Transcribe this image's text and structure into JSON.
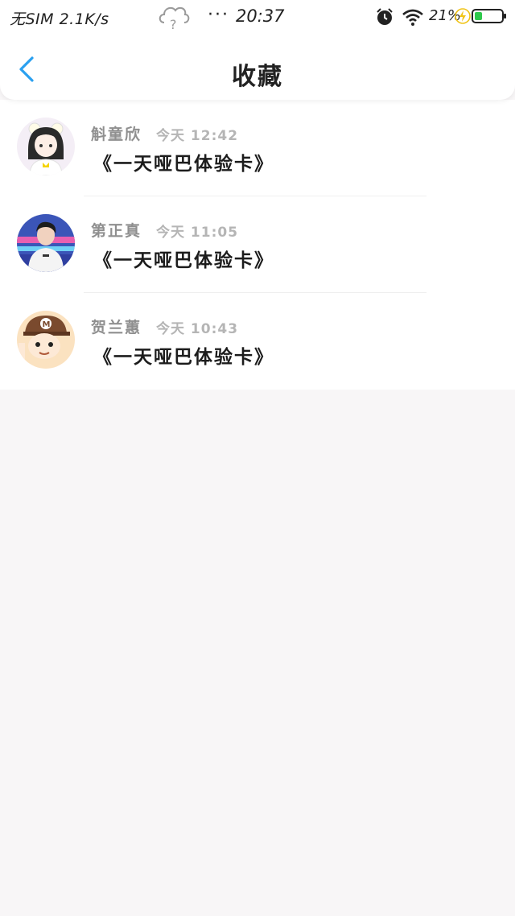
{
  "status_bar": {
    "carrier": "无SIM 2.1K/s",
    "dots": "···",
    "time": "20:37",
    "battery_percent": "21%",
    "icons": [
      "cloud-question-icon",
      "alarm-icon",
      "wifi-icon",
      "charging-bolt-icon",
      "battery-icon"
    ]
  },
  "navbar": {
    "title": "收藏",
    "back_icon": "chevron-left-icon",
    "accent_color": "#2aa0f0"
  },
  "favorites": [
    {
      "name": "斛童欣",
      "time": "今天 12:42",
      "content": "《一天哑巴体验卡》",
      "avatar": "anime-girl-avatar"
    },
    {
      "name": "第正真",
      "time": "今天 11:05",
      "content": "《一天哑巴体验卡》",
      "avatar": "man-photo-avatar"
    },
    {
      "name": "贺兰蕙",
      "time": "今天 10:43",
      "content": "《一天哑巴体验卡》",
      "avatar": "cartoon-boy-avatar"
    }
  ]
}
